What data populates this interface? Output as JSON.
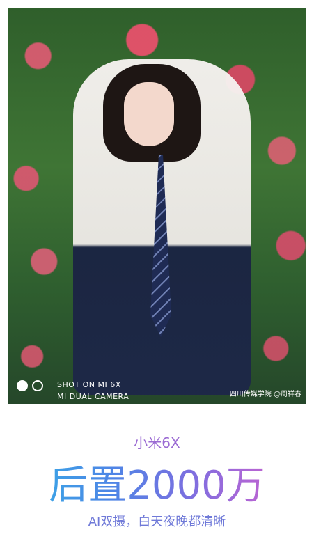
{
  "photo": {
    "camera_badge": {
      "line1": "SHOT ON MI 6X",
      "line2": "MI DUAL CAMERA"
    },
    "credit": "四川传媒学院 @周祥春",
    "icon": "dual-camera-dots-icon"
  },
  "promo": {
    "brand": "小米6X",
    "headline": "后置2000万",
    "subline": "AI双摄，白天夜晚都清晰"
  },
  "colors": {
    "background": "#ffffff",
    "brand_purple": "#9b6bd3",
    "gradient_start": "#2fb6e7",
    "gradient_end": "#d45ab8"
  }
}
